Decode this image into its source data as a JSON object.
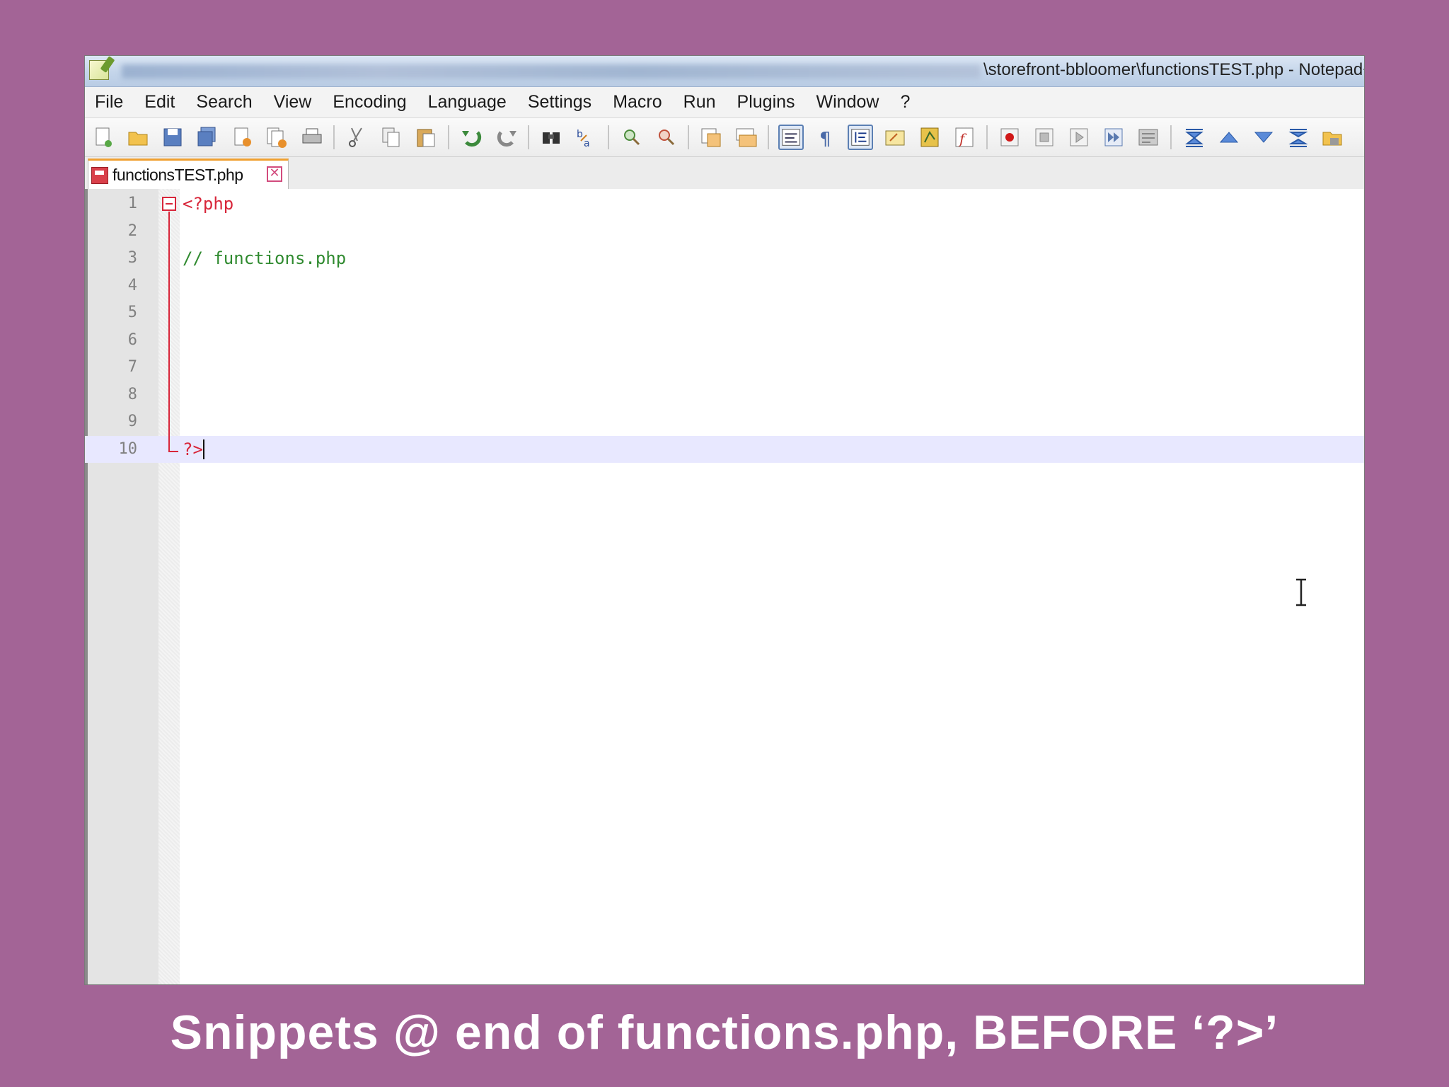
{
  "window": {
    "title": "\\storefront-bbloomer\\functionsTEST.php - Notepad++",
    "app_icon": "notepad-plus-plus-icon"
  },
  "menu": [
    "File",
    "Edit",
    "Search",
    "View",
    "Encoding",
    "Language",
    "Settings",
    "Macro",
    "Run",
    "Plugins",
    "Window",
    "?"
  ],
  "toolbar": {
    "groups": [
      [
        "new-file-icon",
        "open-file-icon",
        "save-icon",
        "save-all-icon",
        "close-icon",
        "close-all-icon",
        "print-icon"
      ],
      [
        "cut-icon",
        "copy-icon",
        "paste-icon"
      ],
      [
        "undo-icon",
        "redo-icon"
      ],
      [
        "find-icon",
        "replace-icon"
      ],
      [
        "zoom-in-icon",
        "zoom-out-icon"
      ],
      [
        "sync-vertical-icon",
        "sync-horizontal-icon"
      ],
      [
        "word-wrap-icon",
        "show-all-characters-icon",
        "indent-guide-icon",
        "user-language-icon",
        "document-map-icon",
        "function-list-icon"
      ],
      [
        "record-macro-icon",
        "stop-recording-icon",
        "playback-macro-icon",
        "run-macro-multiple-icon",
        "save-macro-icon"
      ],
      [
        "collapse-all-icon",
        "previous-icon",
        "next-icon",
        "expand-all-icon",
        "folder-workspace-icon"
      ]
    ],
    "pressed": [
      "word-wrap-icon",
      "indent-guide-icon"
    ]
  },
  "tab": {
    "label": "functionsTEST.php",
    "close_symbol": "✕"
  },
  "editor": {
    "lines": [
      {
        "n": "1",
        "text": "<?php",
        "kind": "keyword"
      },
      {
        "n": "2",
        "text": "",
        "kind": "plain"
      },
      {
        "n": "3",
        "text": "// functions.php",
        "kind": "comment"
      },
      {
        "n": "4",
        "text": "",
        "kind": "plain"
      },
      {
        "n": "5",
        "text": "",
        "kind": "plain"
      },
      {
        "n": "6",
        "text": "",
        "kind": "plain"
      },
      {
        "n": "7",
        "text": "",
        "kind": "plain"
      },
      {
        "n": "8",
        "text": "",
        "kind": "plain"
      },
      {
        "n": "9",
        "text": "",
        "kind": "plain"
      },
      {
        "n": "10",
        "text": "?>",
        "kind": "keyword"
      }
    ],
    "current_line": "10"
  },
  "caption": "Snippets @ end of functions.php, BEFORE ‘?>’"
}
